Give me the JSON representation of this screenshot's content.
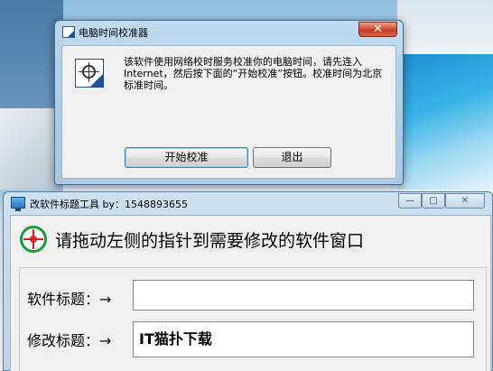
{
  "dialog": {
    "title": "电脑时间校准器",
    "close_glyph": "✕",
    "message": "该软件使用网络校时服务校准你的电脑时间，请先连入 Internet，然后按下面的“开始校准”按钮。校准时间为北京标准时间。",
    "start_button": "开始校准",
    "quit_button": "退出"
  },
  "tool": {
    "title": "改软件标题工具 by：1548893655",
    "minimize_glyph": "—",
    "maximize_glyph": "□",
    "close_glyph": "✕",
    "instruction": "请拖动左侧的指针到需要修改的软件窗口",
    "original_title_label": "软件标题：→",
    "original_title_value": "",
    "new_title_label": "修改标题：→",
    "new_title_value": "IT猫扑下载"
  }
}
